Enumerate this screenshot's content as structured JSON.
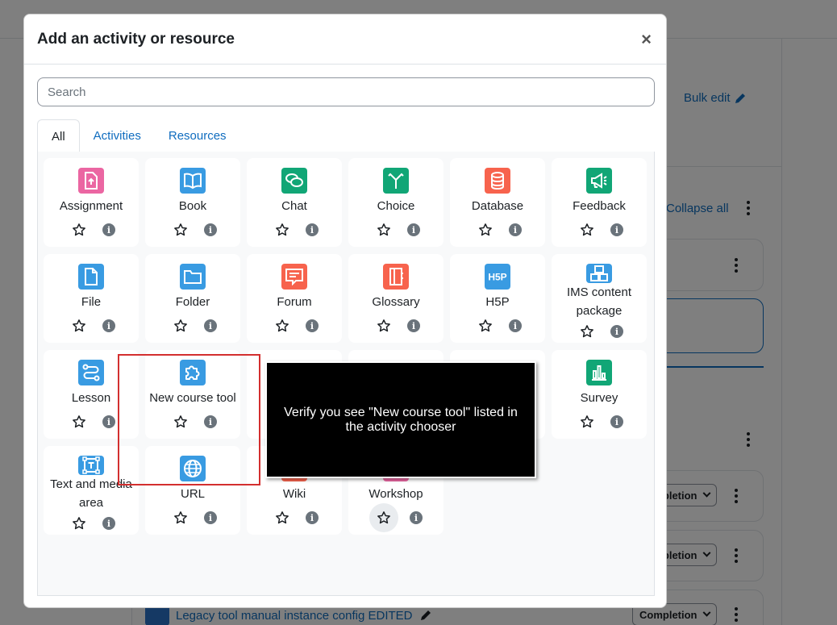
{
  "background": {
    "bulk_edit": "Bulk edit",
    "collapse_all": "Collapse all",
    "completion_buttons": [
      "Completion",
      "Completion",
      "Completion"
    ],
    "legacy_link": "Legacy tool manual instance config EDITED"
  },
  "modal": {
    "title": "Add an activity or resource",
    "close_symbol": "×",
    "search_placeholder": "Search",
    "tabs": [
      {
        "label": "All",
        "active": true
      },
      {
        "label": "Activities",
        "active": false
      },
      {
        "label": "Resources",
        "active": false
      }
    ],
    "info_symbol": "i",
    "items": [
      {
        "name": "Assignment",
        "icon": "assignment-icon",
        "color": "#eb66a2"
      },
      {
        "name": "Book",
        "icon": "book-icon",
        "color": "#399be2"
      },
      {
        "name": "Chat",
        "icon": "chat-icon",
        "color": "#11a676"
      },
      {
        "name": "Choice",
        "icon": "choice-icon",
        "color": "#11a676"
      },
      {
        "name": "Database",
        "icon": "database-icon",
        "color": "#f7634d"
      },
      {
        "name": "Feedback",
        "icon": "feedback-icon",
        "color": "#11a676"
      },
      {
        "name": "File",
        "icon": "file-icon",
        "color": "#399be2"
      },
      {
        "name": "Folder",
        "icon": "folder-icon",
        "color": "#399be2"
      },
      {
        "name": "Forum",
        "icon": "forum-icon",
        "color": "#f7634d"
      },
      {
        "name": "Glossary",
        "icon": "glossary-icon",
        "color": "#f7634d"
      },
      {
        "name": "H5P",
        "icon": "h5p-icon",
        "color": "#399be2"
      },
      {
        "name": "IMS content package",
        "icon": "ims-package-icon",
        "color": "#399be2"
      },
      {
        "name": "Lesson",
        "icon": "lesson-icon",
        "color": "#399be2"
      },
      {
        "name": "New course tool",
        "icon": "puzzle-icon",
        "color": "#399be2"
      },
      {
        "name": "",
        "icon": "",
        "color": ""
      },
      {
        "name": "",
        "icon": "",
        "color": ""
      },
      {
        "name": "",
        "icon": "",
        "color": ""
      },
      {
        "name": "Survey",
        "icon": "survey-icon",
        "color": "#11a676"
      },
      {
        "name": "Text and media area",
        "icon": "text-media-icon",
        "color": "#399be2"
      },
      {
        "name": "URL",
        "icon": "url-globe-icon",
        "color": "#399be2"
      },
      {
        "name": "Wiki",
        "icon": "wiki-icon",
        "color": "#f7634d"
      },
      {
        "name": "Workshop",
        "icon": "workshop-icon",
        "color": "#eb66a2"
      }
    ]
  },
  "annotation": {
    "callout_text": "Verify you see \"New course tool\" listed in the activity chooser"
  }
}
